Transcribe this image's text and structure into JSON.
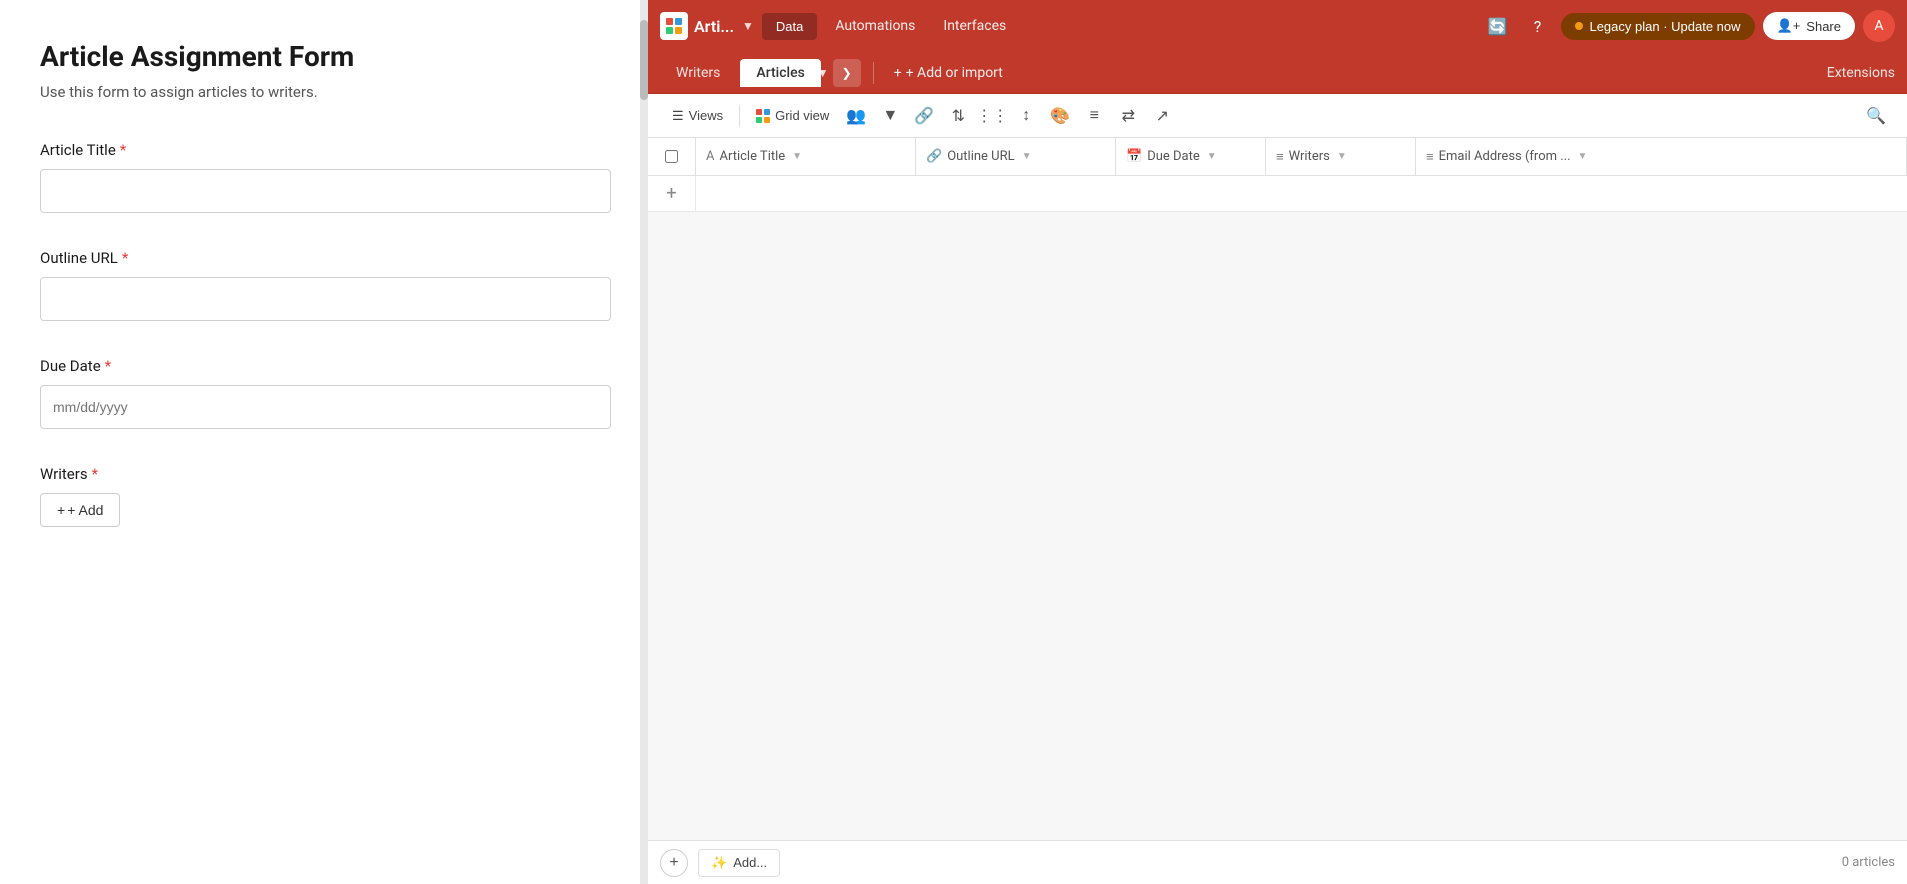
{
  "app": {
    "title": "Arti...",
    "logo_text": "Arti...",
    "nav_items": [
      "Data",
      "Automations",
      "Interfaces"
    ],
    "legacy_label": "Legacy plan · Update now",
    "share_label": "Share"
  },
  "secondary_nav": {
    "tabs": [
      "Writers",
      "Articles"
    ],
    "active_tab": "Articles",
    "add_import_label": "+ Add or import",
    "extensions_label": "Extensions"
  },
  "toolbar": {
    "views_label": "Views",
    "grid_view_label": "Grid view",
    "search_placeholder": "Search"
  },
  "grid": {
    "columns": [
      {
        "id": "title",
        "icon": "A",
        "label": "Article Title",
        "type": "text"
      },
      {
        "id": "url",
        "icon": "🔗",
        "label": "Outline URL",
        "type": "url"
      },
      {
        "id": "due",
        "icon": "📅",
        "label": "Due Date",
        "type": "date"
      },
      {
        "id": "writers",
        "icon": "≡",
        "label": "Writers",
        "type": "link"
      },
      {
        "id": "email",
        "icon": "≡",
        "label": "Email Address (from ...",
        "type": "lookup"
      }
    ],
    "row_count": 0,
    "row_count_label": "0 articles",
    "add_btn_label": "+",
    "add_ai_label": "Add...",
    "plus_label": "+"
  },
  "form": {
    "title": "Article Assignment Form",
    "subtitle": "Use this form to assign articles to writers.",
    "fields": [
      {
        "id": "article_title",
        "label": "Article Title",
        "required": true,
        "type": "text",
        "placeholder": ""
      },
      {
        "id": "outline_url",
        "label": "Outline URL",
        "required": true,
        "type": "text",
        "placeholder": ""
      },
      {
        "id": "due_date",
        "label": "Due Date",
        "required": true,
        "type": "date",
        "placeholder": "mm/dd/yyyy"
      },
      {
        "id": "writers",
        "label": "Writers",
        "required": true,
        "type": "link",
        "placeholder": ""
      }
    ],
    "add_button_label": "+ Add",
    "required_symbol": "*"
  },
  "colors": {
    "brand_red": "#c0392b",
    "dark_red": "#a93226",
    "required_red": "#e53935",
    "legacy_bg": "#7d3c00",
    "accent_orange": "#f39c12"
  }
}
